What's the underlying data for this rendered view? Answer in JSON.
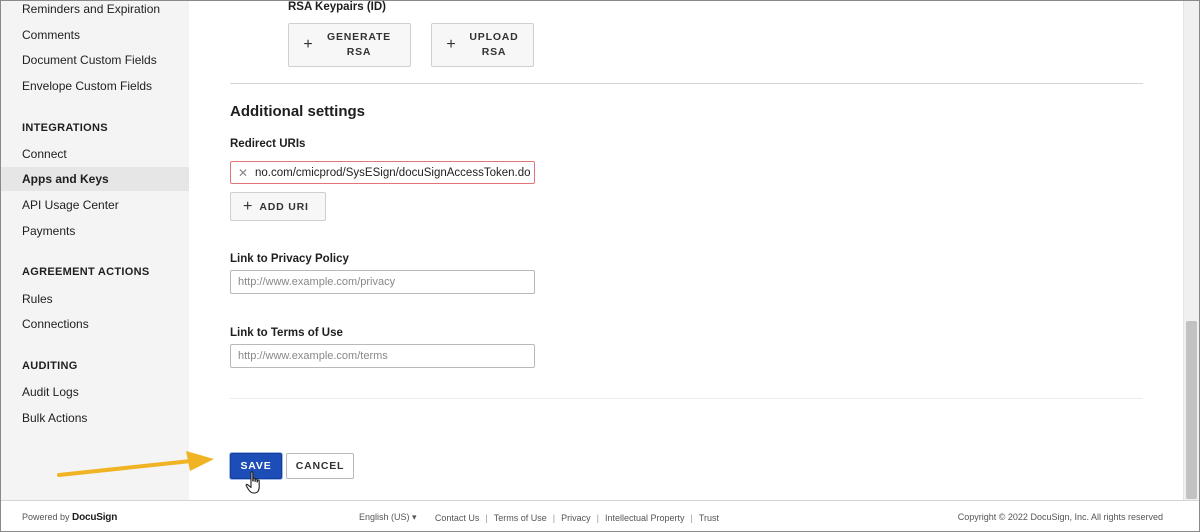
{
  "sidebar": {
    "items": [
      {
        "label": "Reminders and Expiration"
      },
      {
        "label": "Comments"
      },
      {
        "label": "Document Custom Fields"
      },
      {
        "label": "Envelope Custom Fields"
      }
    ],
    "sections": [
      {
        "title": "INTEGRATIONS",
        "items": [
          "Connect",
          "Apps and Keys",
          "API Usage Center",
          "Payments"
        ]
      },
      {
        "title": "AGREEMENT ACTIONS",
        "items": [
          "Rules",
          "Connections"
        ]
      },
      {
        "title": "AUDITING",
        "items": [
          "Audit Logs",
          "Bulk Actions"
        ]
      }
    ],
    "active_item": "Apps and Keys"
  },
  "rsa": {
    "heading": "RSA Keypairs (ID)",
    "generate_label": "GENERATE RSA",
    "upload_label": "UPLOAD RSA"
  },
  "additional": {
    "title": "Additional settings",
    "redirect_label": "Redirect URIs",
    "redirect_value": "no.com/cmicprod/SysESign/docuSignAccessToken.do",
    "add_uri_label": "ADD URI",
    "privacy_label": "Link to Privacy Policy",
    "privacy_placeholder": "http://www.example.com/privacy",
    "terms_label": "Link to Terms of Use",
    "terms_placeholder": "http://www.example.com/terms"
  },
  "actions": {
    "save_label": "SAVE",
    "cancel_label": "CANCEL"
  },
  "footer": {
    "powered_by": "Powered by",
    "brand": "DocuSign",
    "language": "English (US) ▾",
    "links": [
      "Contact Us",
      "Terms of Use",
      "Privacy",
      "Intellectual Property",
      "Trust"
    ],
    "copyright": "Copyright © 2022 DocuSign, Inc. All rights reserved"
  },
  "colors": {
    "primary": "#1d4db6",
    "error_border": "#e0767b",
    "annotation_arrow": "#f0b323"
  },
  "icons": [
    "plus-icon",
    "close-icon",
    "pointer-hand-icon",
    "chevron-down-icon"
  ]
}
